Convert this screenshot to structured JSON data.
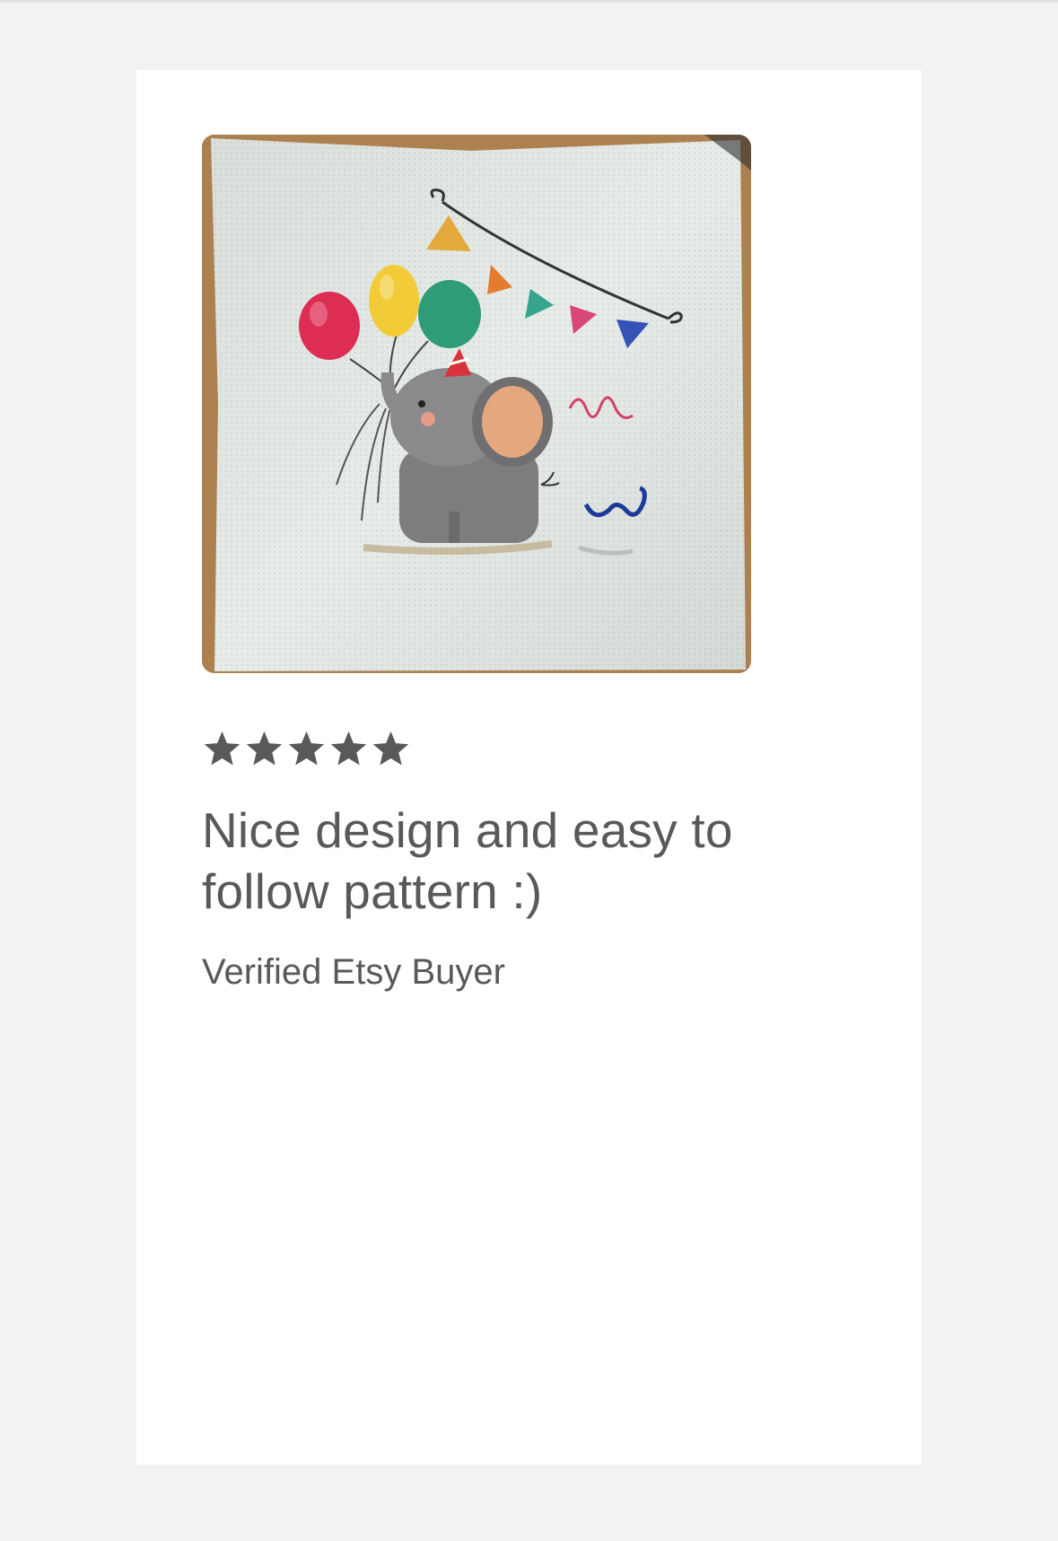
{
  "review": {
    "image": {
      "alt": "Cross-stitched elephant with balloons and bunting"
    },
    "rating": 5,
    "rating_icon": "star-icon",
    "title": "Nice design and easy to follow pattern :)",
    "reviewer": "Verified Etsy Buyer"
  },
  "colors": {
    "page_background": "#f2f2f2",
    "card_background": "#ffffff",
    "text": "#595959",
    "star": "#595959"
  }
}
